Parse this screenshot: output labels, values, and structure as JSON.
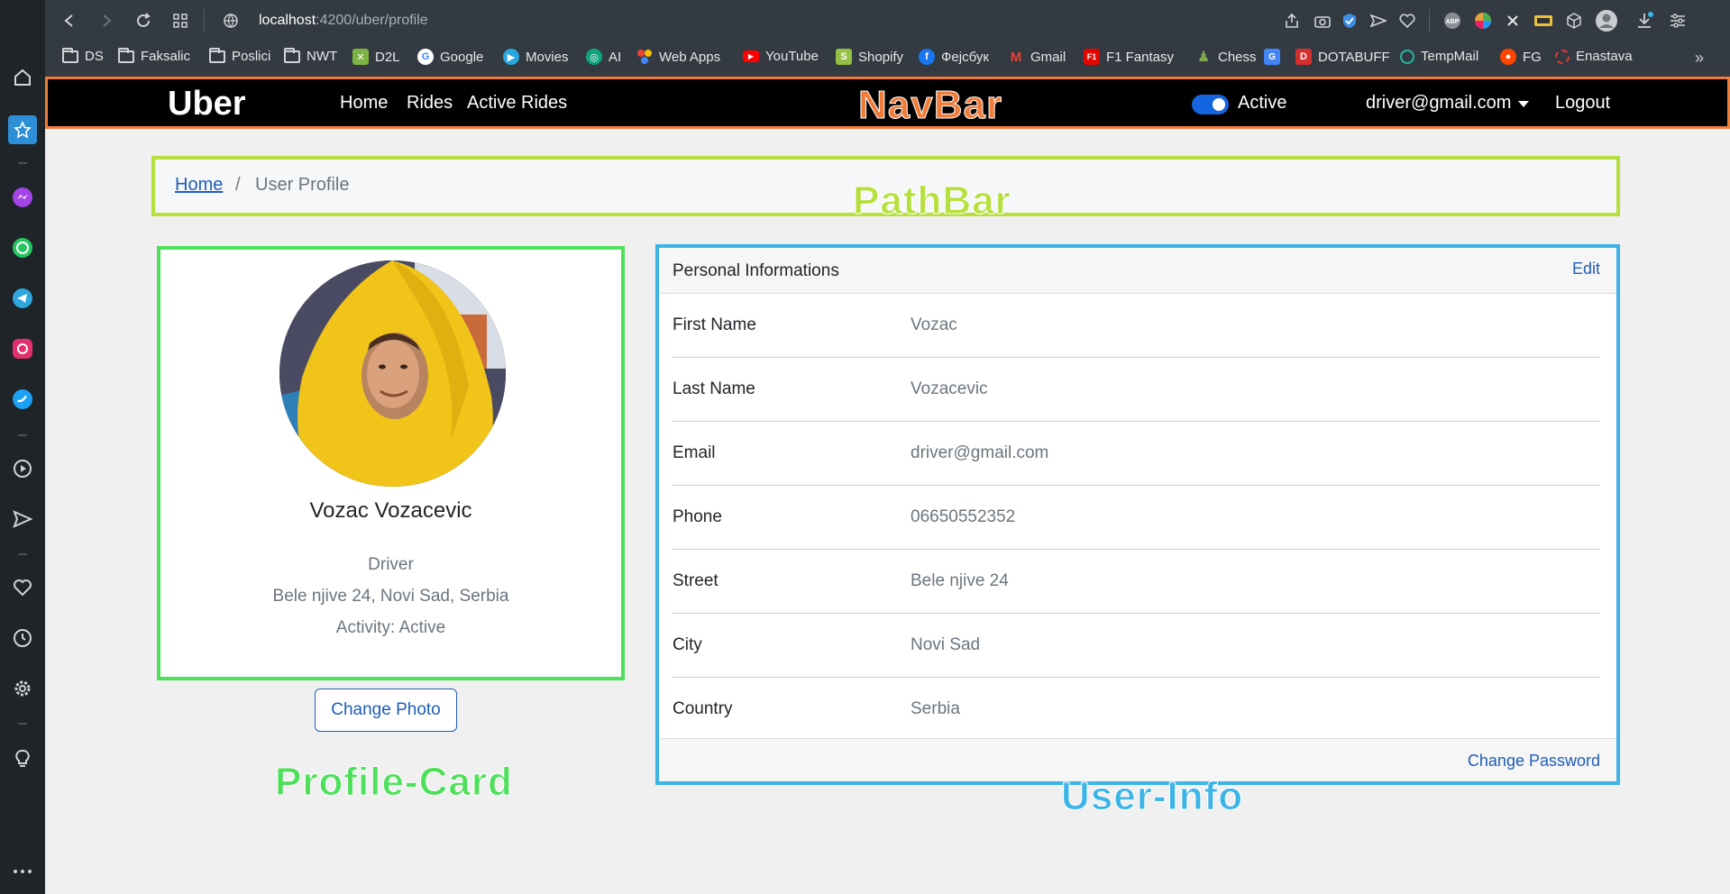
{
  "browser": {
    "url_host": "localhost",
    "url_path": ":4200/uber/profile",
    "bookmarks": [
      {
        "label": "DS",
        "icon": "folder-icon"
      },
      {
        "label": "Faksalic",
        "icon": "folder-icon"
      },
      {
        "label": "Poslici",
        "icon": "folder-icon"
      },
      {
        "label": "NWT",
        "icon": "folder-icon"
      },
      {
        "label": "D2L",
        "icon": "d2l-icon"
      },
      {
        "label": "Google",
        "icon": "google-icon"
      },
      {
        "label": "Movies",
        "icon": "movies-icon"
      },
      {
        "label": "AI",
        "icon": "ai-icon"
      },
      {
        "label": "Web Apps",
        "icon": "web-apps-icon"
      },
      {
        "label": "YouTube",
        "icon": "youtube-icon"
      },
      {
        "label": "Shopify",
        "icon": "shopify-icon"
      },
      {
        "label": "Фејсбук",
        "icon": "facebook-icon"
      },
      {
        "label": "Gmail",
        "icon": "gmail-icon"
      },
      {
        "label": "F1 Fantasy",
        "icon": "f1-icon"
      },
      {
        "label": "Chess",
        "icon": "chess-icon"
      },
      {
        "label": "",
        "icon": "translate-icon"
      },
      {
        "label": "DOTABUFF",
        "icon": "dotabuff-icon"
      },
      {
        "label": "TempMail",
        "icon": "tempmail-icon"
      },
      {
        "label": "FG",
        "icon": "reddit-icon"
      },
      {
        "label": "Enastava",
        "icon": "enastava-icon"
      }
    ]
  },
  "navbar": {
    "brand": "Uber",
    "links": [
      "Home",
      "Rides",
      "Active Rides"
    ],
    "annotation": "NavBar",
    "status_label": "Active",
    "status_on": true,
    "user_email": "driver@gmail.com",
    "logout": "Logout"
  },
  "pathbar": {
    "home": "Home",
    "separator": "/",
    "current": "User Profile",
    "annotation": "PathBar"
  },
  "profile_card": {
    "name": "Vozac Vozacevic",
    "role": "Driver",
    "address": "Bele njive 24, Novi Sad, Serbia",
    "activity": "Activity: Active",
    "change_photo": "Change Photo",
    "annotation": "Profile-Card"
  },
  "user_info": {
    "title": "Personal Informations",
    "edit": "Edit",
    "rows": [
      {
        "label": "First Name",
        "value": "Vozac"
      },
      {
        "label": "Last Name",
        "value": "Vozacevic"
      },
      {
        "label": "Email",
        "value": "driver@gmail.com"
      },
      {
        "label": "Phone",
        "value": "06650552352"
      },
      {
        "label": "Street",
        "value": "Bele njive 24"
      },
      {
        "label": "City",
        "value": "Novi Sad"
      },
      {
        "label": "Country",
        "value": "Serbia"
      }
    ],
    "change_password": "Change Password",
    "annotation": "User-Info"
  },
  "colors": {
    "navbar_border": "#f07c3a",
    "pathbar_border": "#b5e03d",
    "profile_border": "#4fe05b",
    "userinfo_border": "#3db4e6",
    "link": "#1f5db8",
    "toggle_on": "#1565e0"
  }
}
